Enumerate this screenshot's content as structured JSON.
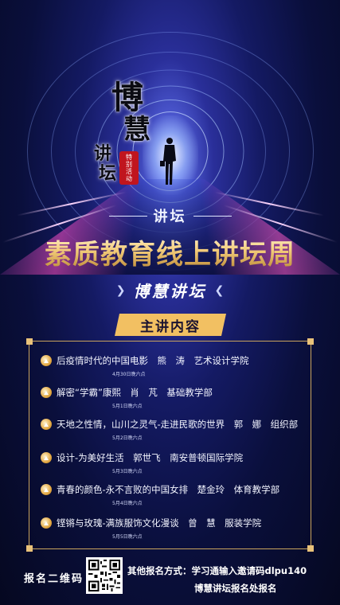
{
  "calligraphy": {
    "bo": "博",
    "hui": "慧",
    "jiang": "讲",
    "tan": "坛"
  },
  "seal_text": "特别活动",
  "header": {
    "tag": "讲坛",
    "title": "素质教育线上讲坛周",
    "subtitle": "博慧讲坛",
    "section": "主讲内容"
  },
  "lectures": [
    {
      "text": "后疫情时代的中国电影　熊　涛　艺术设计学院",
      "date": "4月30日晚六点"
    },
    {
      "text": "解密“学霸”康熙　肖　芃　基础教学部",
      "date": "5月1日晚六点"
    },
    {
      "text": "天地之性情，山川之灵气-走进民歌的世界　郭　娜　组织部",
      "date": "5月2日晚六点"
    },
    {
      "text": "设计-为美好生活　郭世飞　南安普顿国际学院",
      "date": "5月3日晚六点"
    },
    {
      "text": "青春的颜色-永不言败的中国女排　楚金玲　体育教学部",
      "date": "5月4日晚六点"
    },
    {
      "text": "铿锵与玫瑰-满族服饰文化漫谈　曾　慧　服装学院",
      "date": "5月5日晚六点"
    }
  ],
  "footer": {
    "qr_label": "报名二维码",
    "line1": "其他报名方式：学习通输入邀请码dlpu140",
    "line2": "博慧讲坛报名处报名"
  },
  "colors": {
    "gold": "#f2c062",
    "border": "#caa45d",
    "seal": "#c0151e"
  }
}
